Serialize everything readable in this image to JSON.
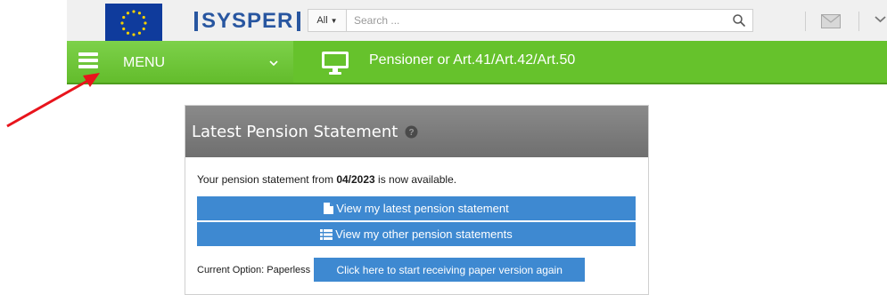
{
  "header": {
    "logo_text": "SYSPER",
    "search": {
      "scope": "All",
      "placeholder": "Search ..."
    }
  },
  "nav": {
    "menu_label": "MENU",
    "role_title": "Pensioner or Art.41/Art.42/Art.50"
  },
  "panel": {
    "title": "Latest Pension Statement",
    "statement_prefix": "Your pension statement from ",
    "statement_date": "04/2023",
    "statement_suffix": " is now available.",
    "view_latest_label": "View my latest pension statement",
    "view_other_label": "View my other pension statements",
    "current_option_label": "Current Option: Paperless",
    "paper_button_label": "Click here to start receiving paper version again"
  },
  "colors": {
    "nav_green": "#66c22c",
    "button_blue": "#3e89d1",
    "panel_header_gray": "#7a7a7a",
    "logo_blue": "#2856a0",
    "annotation_arrow": "#e8141c"
  },
  "icons": [
    "eu-flag",
    "search-icon",
    "mail-icon",
    "chevron-down-icon",
    "hamburger-icon",
    "monitor-icon",
    "help-icon",
    "document-icon",
    "list-icon",
    "red-arrow"
  ]
}
